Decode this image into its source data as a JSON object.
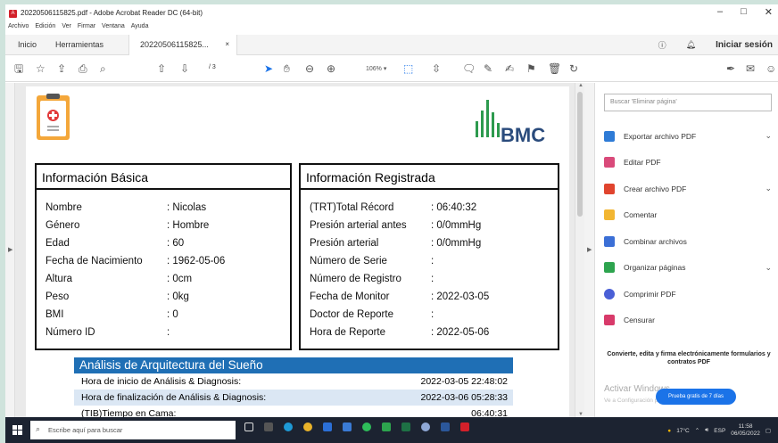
{
  "window": {
    "title": "20220506115825.pdf - Adobe Acrobat Reader DC (64-bit)",
    "icon_text": "A"
  },
  "menu": [
    "Archivo",
    "Edición",
    "Ver",
    "Firmar",
    "Ventana",
    "Ayuda"
  ],
  "tabs": {
    "home": "Inicio",
    "tools": "Herramientas",
    "doc": "20220506115825...",
    "close": "×",
    "signin": "Iniciar sesión"
  },
  "toolbar": {
    "page_current": "1",
    "page_total": "/ 3",
    "zoom": "106%"
  },
  "pdf": {
    "logo_text": "BMC",
    "basic": {
      "title": "Información Básica",
      "rows": [
        {
          "label": "Nombre",
          "value": ": Nicolas"
        },
        {
          "label": "Género",
          "value": ": Hombre"
        },
        {
          "label": "Edad",
          "value": ": 60"
        },
        {
          "label": "Fecha de Nacimiento",
          "value": ": 1962-05-06"
        },
        {
          "label": "Altura",
          "value": ": 0cm"
        },
        {
          "label": "Peso",
          "value": ": 0kg"
        },
        {
          "label": "BMI",
          "value": ": 0"
        },
        {
          "label": "Número ID",
          "value": ":"
        }
      ]
    },
    "registered": {
      "title": "Información Registrada",
      "rows": [
        {
          "label": "(TRT)Total Récord",
          "value": ": 06:40:32"
        },
        {
          "label": "Presión arterial antes",
          "value": ": 0/0mmHg"
        },
        {
          "label": "Presión arterial",
          "value": ": 0/0mmHg"
        },
        {
          "label": "Número de Serie",
          "value": ":"
        },
        {
          "label": "Número de Registro",
          "value": ":"
        },
        {
          "label": "Fecha de Monitor",
          "value": ": 2022-03-05"
        },
        {
          "label": "Doctor de Reporte",
          "value": ":"
        },
        {
          "label": "Hora de Reporte",
          "value": ": 2022-05-06"
        }
      ]
    },
    "analysis": {
      "title": "Análisis de Arquitectura del Sueño",
      "rows": [
        {
          "label": "Hora de inicio de Análisis & Diagnosis:",
          "value": "2022-03-05 22:48:02"
        },
        {
          "label": "Hora de finalización de Análisis & Diagnosis:",
          "value": "2022-03-06 05:28:33"
        },
        {
          "label": "(TIB)Tiempo en Cama:",
          "value": "06:40:31"
        }
      ]
    }
  },
  "rightpanel": {
    "search_placeholder": "Buscar 'Eliminar página'",
    "tools": [
      {
        "label": "Exportar archivo PDF",
        "color": "#2e7bd6",
        "chevron": "⌄"
      },
      {
        "label": "Editar PDF",
        "color": "#d94a7a",
        "chevron": ""
      },
      {
        "label": "Crear archivo PDF",
        "color": "#e0442e",
        "chevron": "⌄"
      },
      {
        "label": "Comentar",
        "color": "#f2b632",
        "chevron": ""
      },
      {
        "label": "Combinar archivos",
        "color": "#3b6fd6",
        "chevron": ""
      },
      {
        "label": "Organizar páginas",
        "color": "#2da44e",
        "chevron": "⌄"
      },
      {
        "label": "Comprimir PDF",
        "color": "#4a5fd6",
        "chevron": ""
      },
      {
        "label": "Censurar",
        "color": "#d83a6a",
        "chevron": ""
      }
    ],
    "promo": "Convierte, edita y firma electrónicamente formularios y contratos PDF",
    "promo_button": "Prueba gratis de 7 días",
    "activate_title": "Activar Windows",
    "activate_sub": "Ve a Configuración para activar Windows."
  },
  "taskbar": {
    "search": "Escribe aquí para buscar",
    "weather": "17°C",
    "lang": "ESP",
    "time": "11:58",
    "date": "06/05/2022"
  }
}
